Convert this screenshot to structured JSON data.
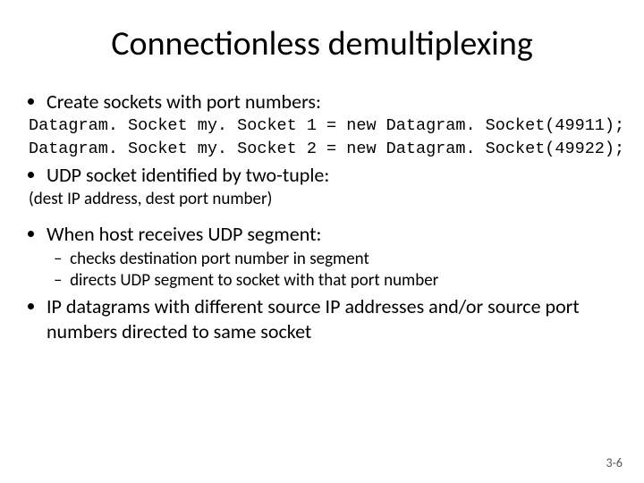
{
  "title": "Connectionless demultiplexing",
  "bullets": {
    "b1": "Create sockets with port numbers:",
    "code1": "Datagram. Socket my. Socket 1 = new Datagram. Socket(49911);",
    "code2": "Datagram. Socket my. Socket 2 = new Datagram. Socket(49922);",
    "b2": "UDP socket identified by two-tuple:",
    "note": "(dest IP address, dest port number)",
    "b3": "When host receives UDP segment:",
    "b3s1": "checks destination port number in segment",
    "b3s2": "directs UDP segment to socket with that port number",
    "b4": "IP datagrams with different source IP addresses and/or source port numbers directed to same socket"
  },
  "pagenum": "3-6"
}
